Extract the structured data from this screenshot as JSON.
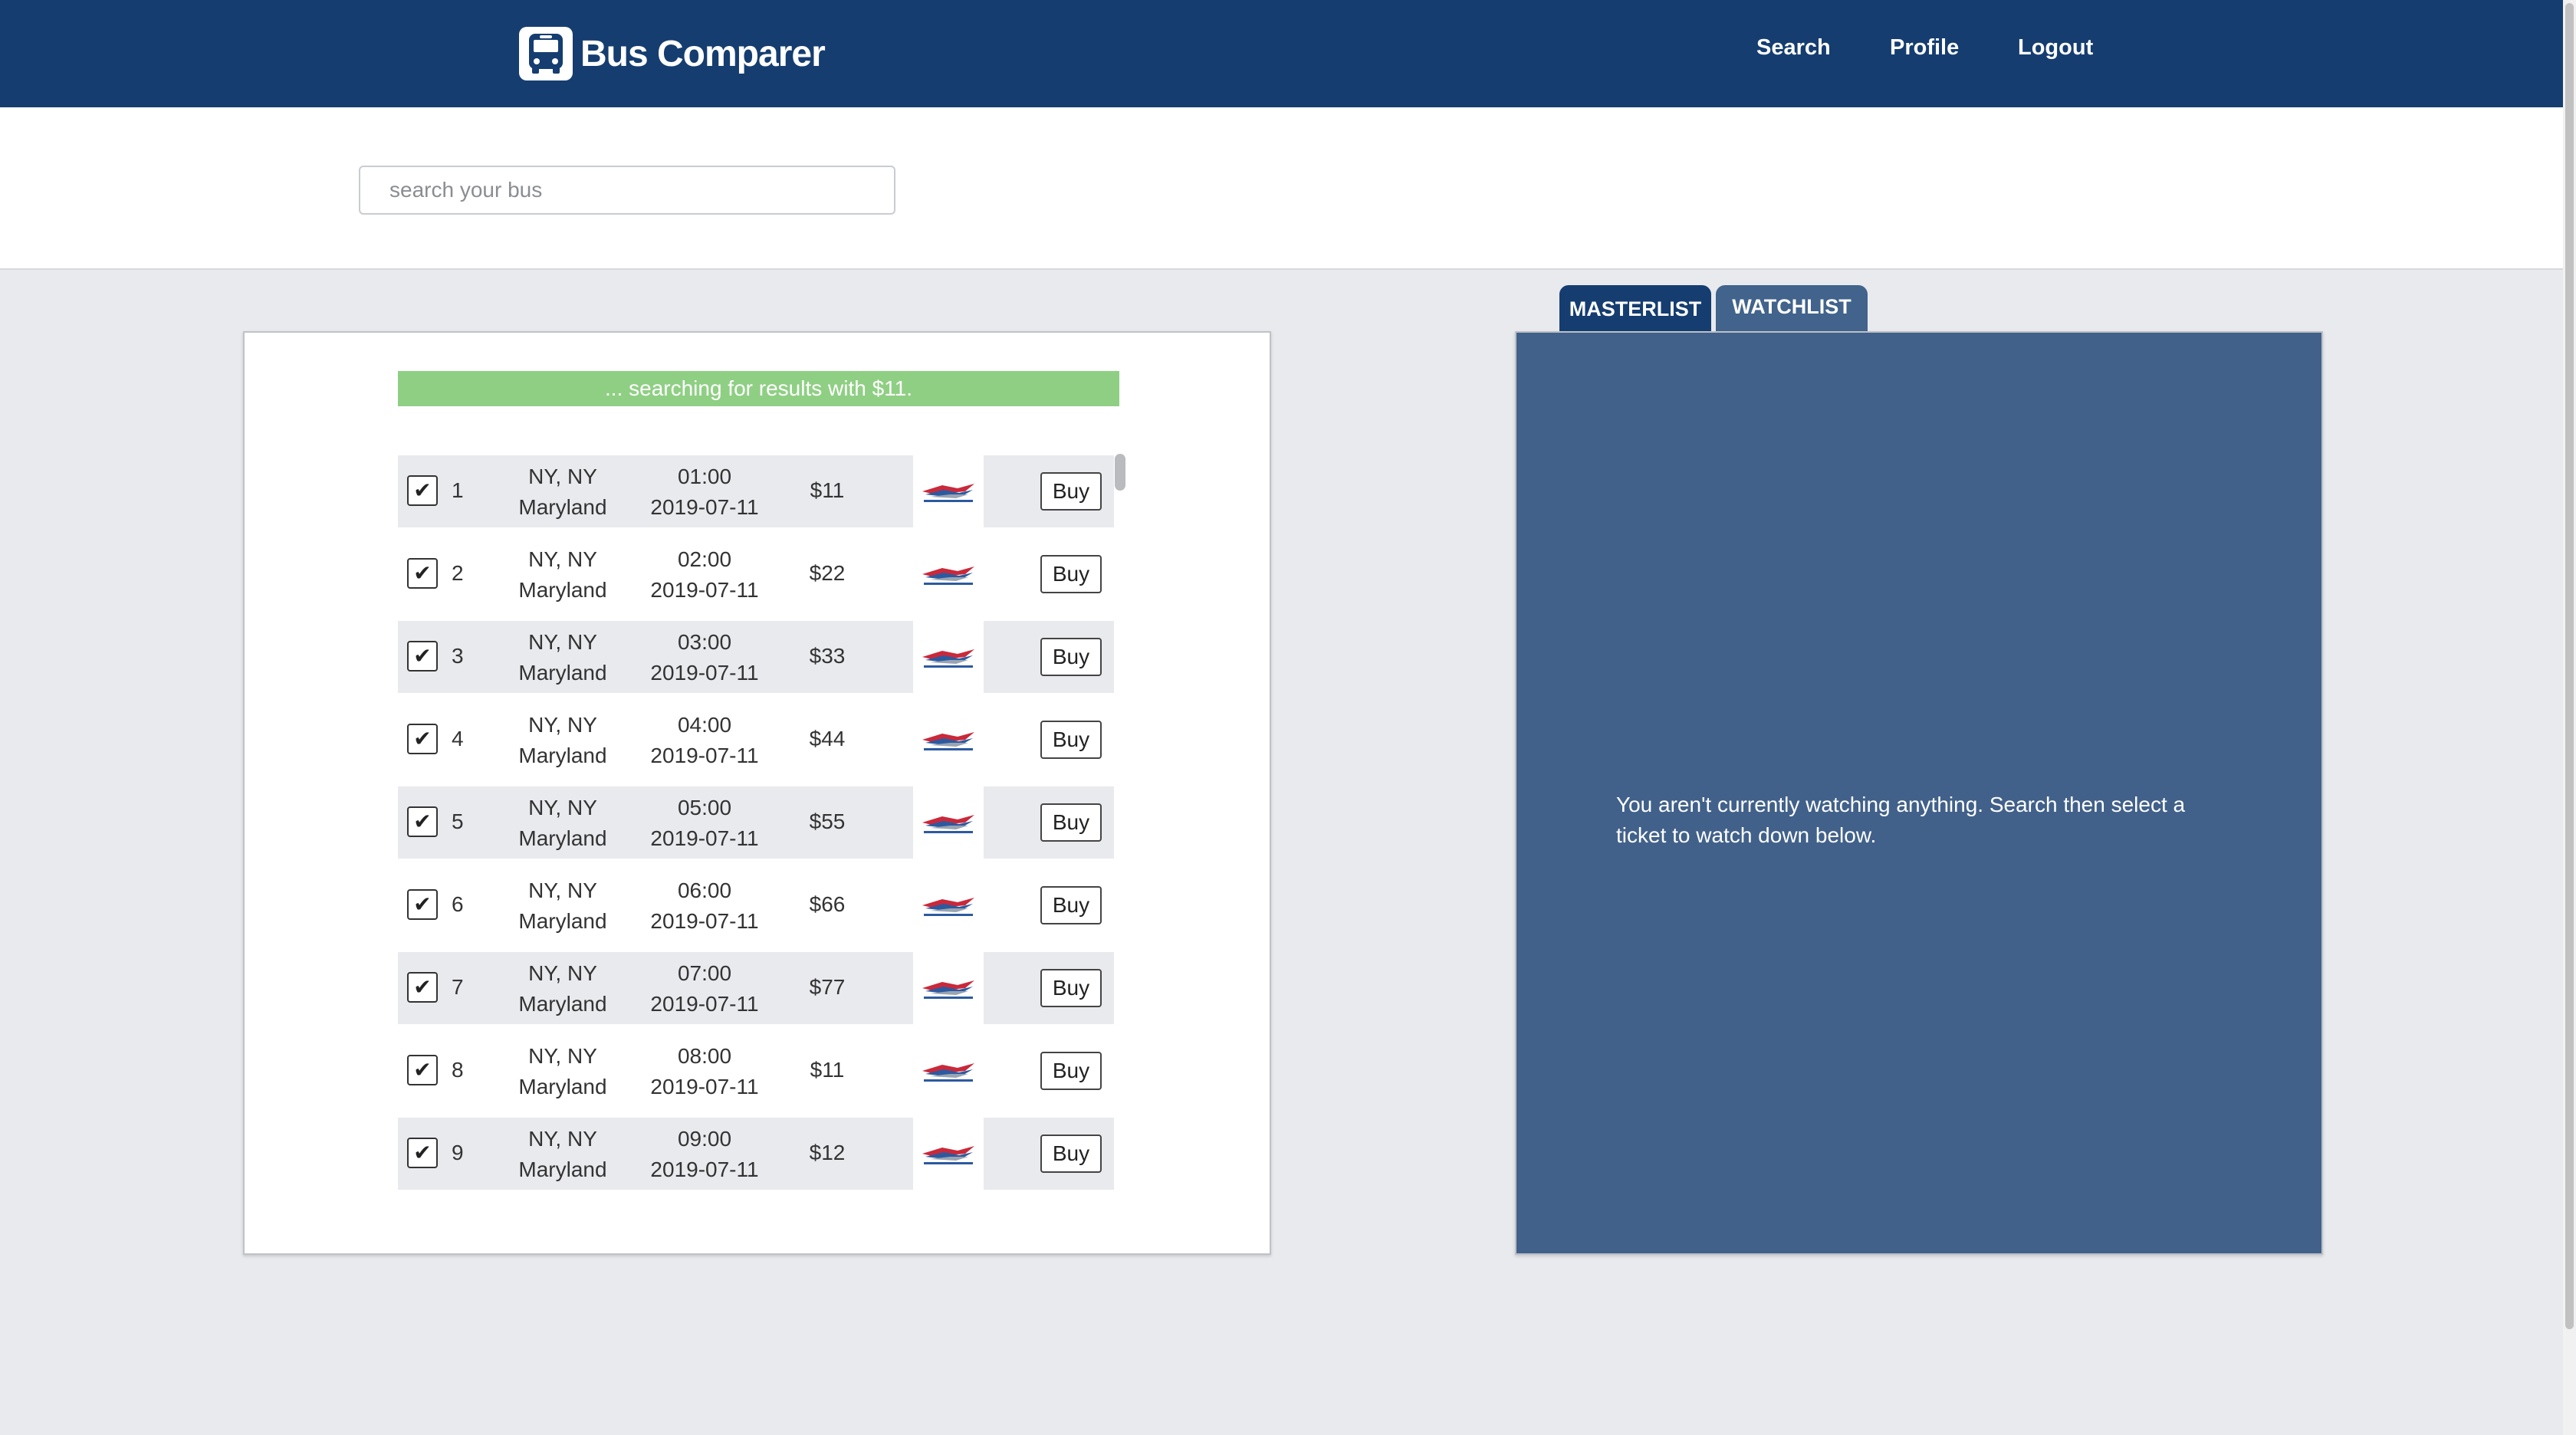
{
  "header": {
    "app_name": "Bus Comparer",
    "nav": [
      "Search",
      "Profile",
      "Logout"
    ]
  },
  "search": {
    "placeholder": "search your bus",
    "value": ""
  },
  "status_message": "... searching for results with $11.",
  "results": [
    {
      "index": "1",
      "from": "NY, NY",
      "to": "Maryland",
      "time": "01:00",
      "date": "2019-07-11",
      "price": "$11",
      "carrier": "greyhound-logo",
      "checked": true,
      "buy_label": "Buy"
    },
    {
      "index": "2",
      "from": "NY, NY",
      "to": "Maryland",
      "time": "02:00",
      "date": "2019-07-11",
      "price": "$22",
      "carrier": "greyhound-logo",
      "checked": true,
      "buy_label": "Buy"
    },
    {
      "index": "3",
      "from": "NY, NY",
      "to": "Maryland",
      "time": "03:00",
      "date": "2019-07-11",
      "price": "$33",
      "carrier": "greyhound-logo",
      "checked": true,
      "buy_label": "Buy"
    },
    {
      "index": "4",
      "from": "NY, NY",
      "to": "Maryland",
      "time": "04:00",
      "date": "2019-07-11",
      "price": "$44",
      "carrier": "greyhound-logo",
      "checked": true,
      "buy_label": "Buy"
    },
    {
      "index": "5",
      "from": "NY, NY",
      "to": "Maryland",
      "time": "05:00",
      "date": "2019-07-11",
      "price": "$55",
      "carrier": "greyhound-logo",
      "checked": true,
      "buy_label": "Buy"
    },
    {
      "index": "6",
      "from": "NY, NY",
      "to": "Maryland",
      "time": "06:00",
      "date": "2019-07-11",
      "price": "$66",
      "carrier": "greyhound-logo",
      "checked": true,
      "buy_label": "Buy"
    },
    {
      "index": "7",
      "from": "NY, NY",
      "to": "Maryland",
      "time": "07:00",
      "date": "2019-07-11",
      "price": "$77",
      "carrier": "greyhound-logo",
      "checked": true,
      "buy_label": "Buy"
    },
    {
      "index": "8",
      "from": "NY, NY",
      "to": "Maryland",
      "time": "08:00",
      "date": "2019-07-11",
      "price": "$11",
      "carrier": "greyhound-logo",
      "checked": true,
      "buy_label": "Buy"
    },
    {
      "index": "9",
      "from": "NY, NY",
      "to": "Maryland",
      "time": "09:00",
      "date": "2019-07-11",
      "price": "$12",
      "carrier": "greyhound-logo",
      "checked": true,
      "buy_label": "Buy"
    }
  ],
  "tabs": {
    "masterlist": "MASTERLIST",
    "watchlist": "WATCHLIST",
    "active": "masterlist"
  },
  "watch_panel": {
    "empty_message": "You aren't currently watching anything. Search then select a ticket to watch down below."
  },
  "colors": {
    "header_bg": "#153d70",
    "panel_bg": "#41618a",
    "status_bg": "#8fcf84"
  }
}
